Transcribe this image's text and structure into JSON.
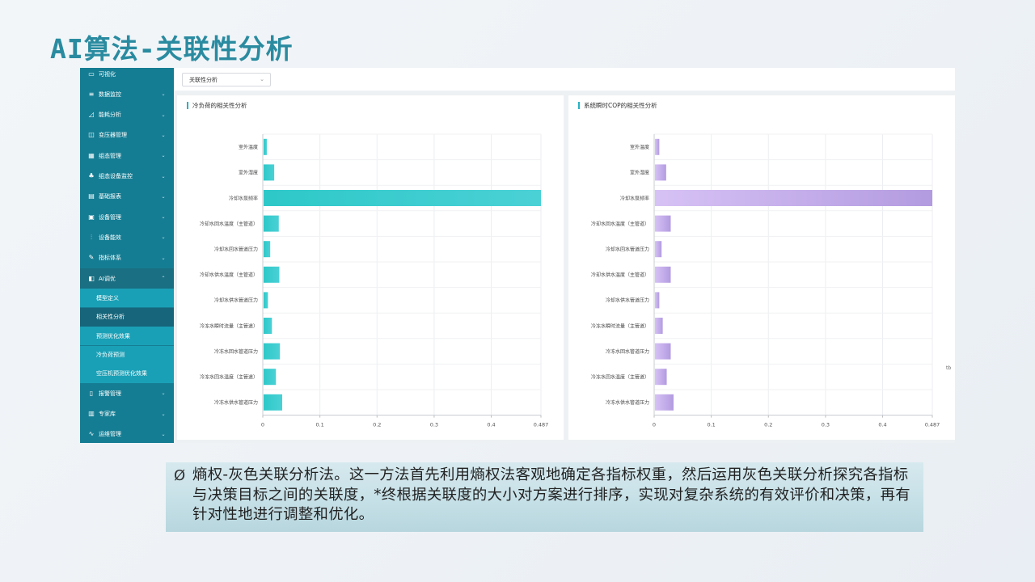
{
  "slide": {
    "title": "AI算法-关联性分析",
    "note_bullet": "Ø",
    "note_text": "熵权-灰色关联分析法。这一方法首先利用熵权法客观地确定各指标权重，然后运用灰色关联分析探究各指标与决策目标之间的关联度，*终根据关联度的大小对方案进行排序，实现对复杂系统的有效评价和决策，再有针对性地进行调整和优化。"
  },
  "sidebar": {
    "items": [
      {
        "label": "可视化",
        "icon": "monitor-icon",
        "glyph": "▭",
        "chev": ""
      },
      {
        "label": "数据监控",
        "icon": "database-icon",
        "glyph": "≡",
        "chev": "⌄"
      },
      {
        "label": "能耗分析",
        "icon": "chart-icon",
        "glyph": "◿",
        "chev": "⌄"
      },
      {
        "label": "变压器管理",
        "icon": "transformer-icon",
        "glyph": "◫",
        "chev": "⌄"
      },
      {
        "label": "组态管理",
        "icon": "grid-icon",
        "glyph": "▦",
        "chev": "⌄"
      },
      {
        "label": "组态设备监控",
        "icon": "network-icon",
        "glyph": "♣",
        "chev": "⌄"
      },
      {
        "label": "基础报表",
        "icon": "report-icon",
        "glyph": "▤",
        "chev": "⌄"
      },
      {
        "label": "设备管理",
        "icon": "device-icon",
        "glyph": "▣",
        "chev": "⌄"
      },
      {
        "label": "设备能效",
        "icon": "efficiency-icon",
        "glyph": "⫶",
        "chev": "⌄"
      },
      {
        "label": "指标体系",
        "icon": "edit-icon",
        "glyph": "✎",
        "chev": "⌄"
      },
      {
        "label": "AI调优",
        "icon": "ai-icon",
        "glyph": "◧",
        "chev": "⌃"
      }
    ],
    "sub_items": [
      "模型定义",
      "相关性分析",
      "预测优化效果",
      "冷负荷预测",
      "空压机预测优化效果"
    ],
    "bottom_items": [
      {
        "label": "报警管理",
        "icon": "alarm-icon",
        "glyph": "▯",
        "chev": "⌄"
      },
      {
        "label": "专家库",
        "icon": "book-icon",
        "glyph": "▥",
        "chev": "⌄"
      },
      {
        "label": "运维管理",
        "icon": "wave-icon",
        "glyph": "∿",
        "chev": "⌄"
      }
    ]
  },
  "toolbar": {
    "select_value": "关联性分析",
    "select_caret": "⌄"
  },
  "side_mark": "tb",
  "colors": {
    "sidebar": "#157d93",
    "teal_start": "#2ec8c8",
    "teal_end": "#4ad1d6",
    "purple_start": "#d7c2f5",
    "purple_end": "#b39be0",
    "title": "#2a8ba0"
  },
  "chart_data": [
    {
      "type": "bar",
      "orientation": "horizontal",
      "title": "冷负荷的相关性分析",
      "categories": [
        "室外温度",
        "室外湿度",
        "冷却水泵频率",
        "冷却水回水温度（主管道）",
        "冷却水回水管道压力",
        "冷却水供水温度（主管道）",
        "冷却水供水管道压力",
        "冷冻水瞬时流量（主管道）",
        "冷冻水回水管道压力",
        "冷冻水回水温度（主管道）",
        "冷冻水供水管道压力"
      ],
      "values": [
        0.007,
        0.02,
        0.487,
        0.028,
        0.013,
        0.029,
        0.009,
        0.016,
        0.03,
        0.023,
        0.034
      ],
      "xlim": [
        0,
        0.487
      ],
      "xticks": [
        "0",
        "0.1",
        "0.2",
        "0.3",
        "0.4",
        "0.487"
      ],
      "grid": true
    },
    {
      "type": "bar",
      "orientation": "horizontal",
      "title": "系统瞬时COP的相关性分析",
      "categories": [
        "室外温度",
        "室外湿度",
        "冷却水泵频率",
        "冷却水回水温度（主管道）",
        "冷却水回水管道压力",
        "冷却水供水温度（主管道）",
        "冷却水供水管道压力",
        "冷冻水瞬时流量（主管道）",
        "冷冻水回水管道压力",
        "冷冻水回水温度（主管道）",
        "冷冻水供水管道压力"
      ],
      "values": [
        0.009,
        0.021,
        0.487,
        0.029,
        0.013,
        0.029,
        0.009,
        0.015,
        0.029,
        0.022,
        0.034
      ],
      "xlim": [
        0,
        0.487
      ],
      "xticks": [
        "0",
        "0.1",
        "0.2",
        "0.3",
        "0.4",
        "0.487"
      ],
      "grid": true
    }
  ]
}
